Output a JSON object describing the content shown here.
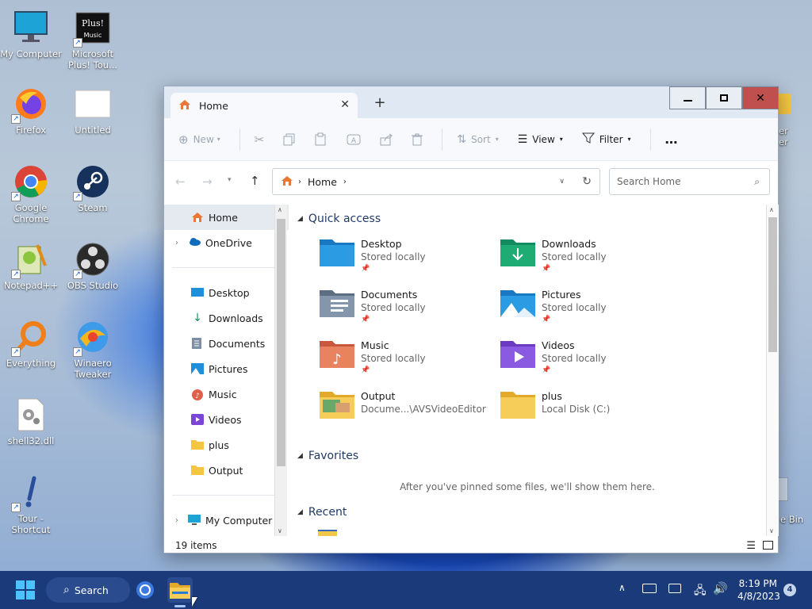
{
  "desktop_icons": [
    {
      "label": "My Computer",
      "icon": "monitor-icon"
    },
    {
      "label": "Microsoft Plus! Tou...",
      "icon": "plus-icon"
    },
    {
      "label": "Firefox",
      "icon": "firefox-icon"
    },
    {
      "label": "Untitled",
      "icon": "blank-file-icon"
    },
    {
      "label": "Google Chrome",
      "icon": "chrome-icon"
    },
    {
      "label": "Steam",
      "icon": "steam-icon"
    },
    {
      "label": "Notepad++",
      "icon": "notepad-icon"
    },
    {
      "label": "OBS Studio",
      "icon": "obs-icon"
    },
    {
      "label": "Everything",
      "icon": "search-icon"
    },
    {
      "label": "Winaero Tweaker",
      "icon": "winaero-icon"
    },
    {
      "label": "shell32.dll",
      "icon": "dll-icon"
    },
    {
      "label": "Tour - Shortcut",
      "icon": "tour-icon"
    }
  ],
  "desktop_partial": {
    "right_top": "er",
    "right_top2": "er",
    "recycle": "e Bin"
  },
  "explorer": {
    "tab_title": "Home",
    "toolbar": {
      "new": "New",
      "sort": "Sort",
      "view": "View",
      "filter": "Filter",
      "more": "…"
    },
    "address": "Home",
    "search_placeholder": "Search Home",
    "nav": {
      "home": "Home",
      "onedrive": "OneDrive",
      "pinned": [
        {
          "label": "Desktop",
          "icon": "desktop-icon"
        },
        {
          "label": "Downloads",
          "icon": "download-icon"
        },
        {
          "label": "Documents",
          "icon": "documents-icon"
        },
        {
          "label": "Pictures",
          "icon": "pictures-icon"
        },
        {
          "label": "Music",
          "icon": "music-icon"
        },
        {
          "label": "Videos",
          "icon": "videos-icon"
        },
        {
          "label": "plus",
          "icon": "folder-icon"
        },
        {
          "label": "Output",
          "icon": "folder-icon"
        }
      ],
      "my_computer": "My Computer"
    },
    "quick_access_title": "Quick access",
    "quick_access": [
      {
        "name": "Desktop",
        "sub": "Stored locally"
      },
      {
        "name": "Downloads",
        "sub": "Stored locally"
      },
      {
        "name": "Documents",
        "sub": "Stored locally"
      },
      {
        "name": "Pictures",
        "sub": "Stored locally"
      },
      {
        "name": "Music",
        "sub": "Stored locally"
      },
      {
        "name": "Videos",
        "sub": "Stored locally"
      },
      {
        "name": "Output",
        "sub": "Docume...\\AVSVideoEditor"
      },
      {
        "name": "plus",
        "sub": "Local Disk (C:)"
      }
    ],
    "favorites_title": "Favorites",
    "favorites_empty": "After you've pinned some files, we'll show them here.",
    "recent_title": "Recent",
    "status": "19 items"
  },
  "taskbar": {
    "search": "Search",
    "time": "8:19 PM",
    "date": "4/8/2023",
    "notif": "4"
  },
  "colors": {
    "taskbar": "#1a3a7a",
    "accent": "#0067c0",
    "close": "#c42b1c"
  }
}
